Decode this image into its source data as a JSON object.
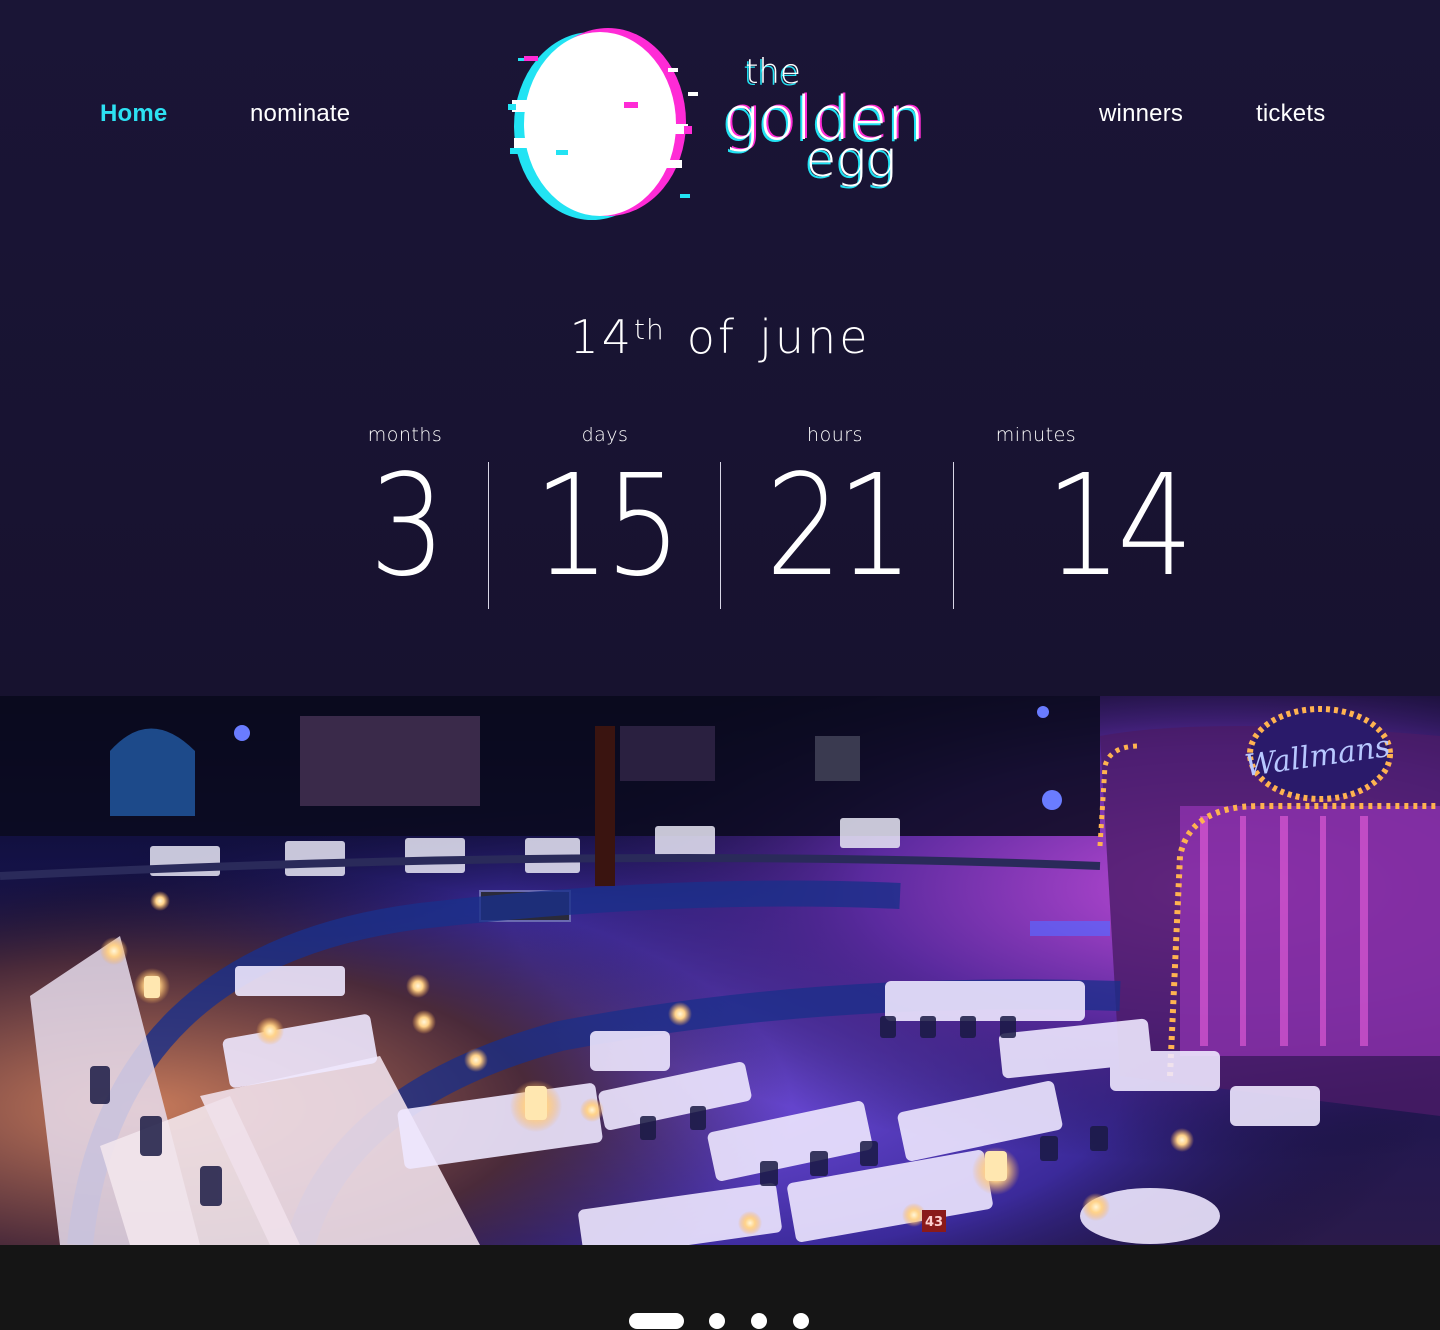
{
  "nav": {
    "left": [
      {
        "label": "Home",
        "active": true
      },
      {
        "label": "nominate",
        "active": false
      }
    ],
    "right": [
      {
        "label": "winners",
        "active": false
      },
      {
        "label": "tickets",
        "active": false
      }
    ]
  },
  "logo": {
    "line1": "the",
    "line2": "golden",
    "line3": "egg"
  },
  "event_date": {
    "day": "14",
    "suffix": "th",
    "rest_of": "of",
    "rest_month": "june"
  },
  "countdown": [
    {
      "label": "months",
      "value": "3"
    },
    {
      "label": "days",
      "value": "15"
    },
    {
      "label": "hours",
      "value": "21"
    },
    {
      "label": "minutes",
      "value": "14"
    }
  ],
  "hero": {
    "venue_sign": "Wallmans",
    "table_number": "43"
  },
  "carousel": {
    "slide_count": 4,
    "active_index": 0
  },
  "colors": {
    "background": "#17122f",
    "accent_cyan": "#2de1f2",
    "accent_magenta": "#ff2bd6",
    "footer": "#151515"
  }
}
